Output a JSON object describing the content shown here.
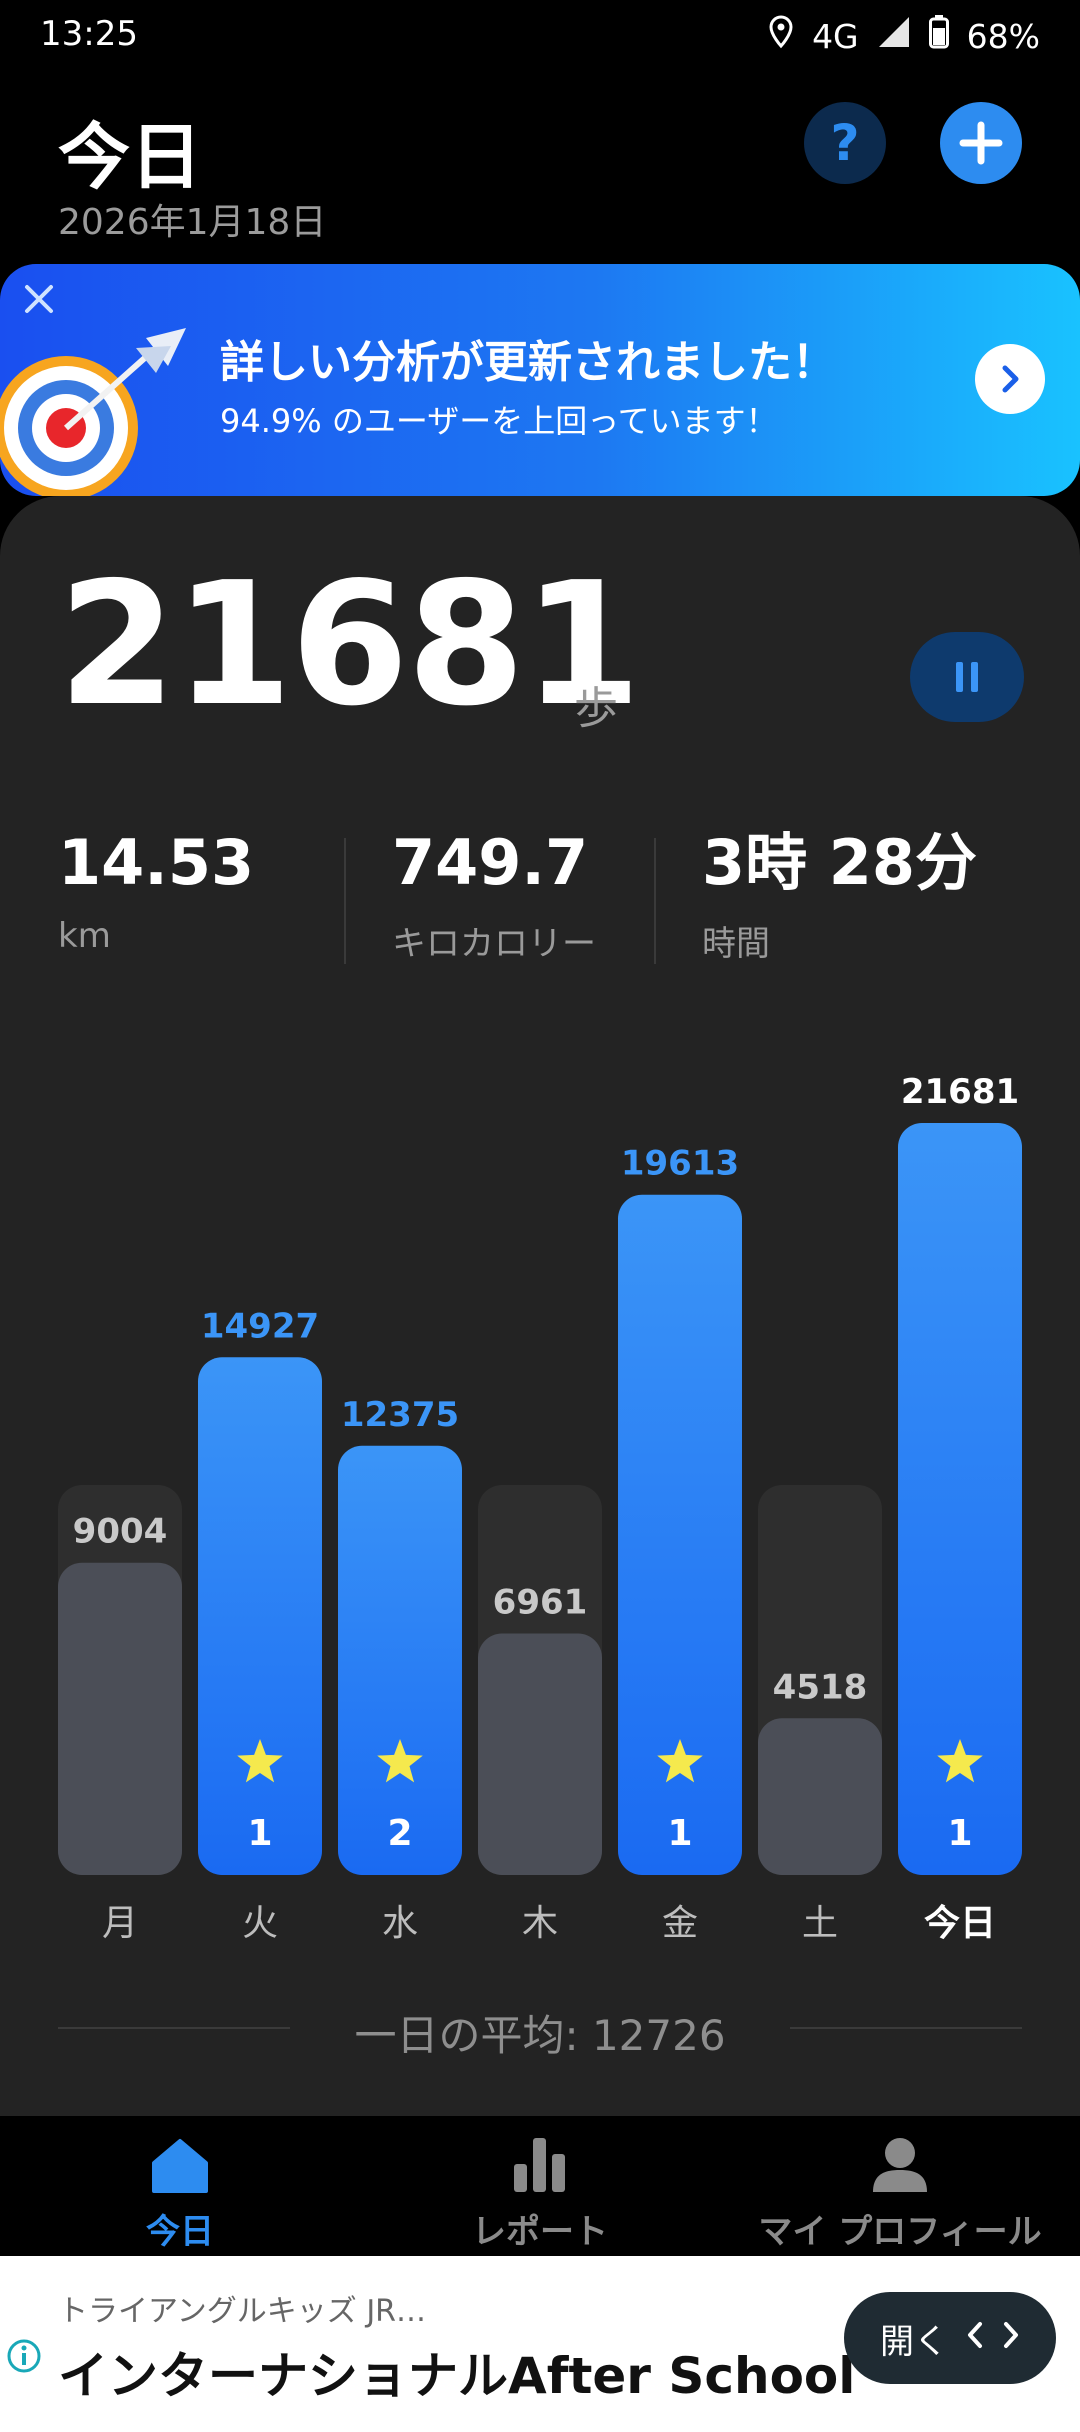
{
  "status_bar": {
    "time": "13:25",
    "network": "4G",
    "battery": "68%",
    "icons": [
      "location-icon",
      "signal-icon",
      "battery-icon"
    ]
  },
  "header": {
    "title": "今日",
    "date": "2026年1月18日",
    "help_icon": "question-icon",
    "add_icon": "plus-icon"
  },
  "banner": {
    "title": "詳しい分析が更新されました！",
    "subtitle": "94.9% のユーザーを上回っています！",
    "close_icon": "close-icon",
    "arrow_icon": "chevron-right-icon"
  },
  "steps": {
    "value": "21681",
    "unit": "歩"
  },
  "stats": [
    {
      "value": "14.53",
      "label": "km"
    },
    {
      "value": "749.7",
      "label": "キロカロリー"
    },
    {
      "value": "3時 28分",
      "label": "時間"
    }
  ],
  "chart_data": {
    "type": "bar",
    "categories": [
      "月",
      "火",
      "水",
      "木",
      "金",
      "土",
      "今日"
    ],
    "values": [
      9004,
      14927,
      12375,
      6961,
      19613,
      4518,
      21681
    ],
    "goal_reached": [
      false,
      true,
      true,
      false,
      true,
      false,
      true
    ],
    "star_counts": [
      null,
      "1",
      "2",
      null,
      "1",
      null,
      "1"
    ],
    "ylim": [
      0,
      21681
    ],
    "colors": {
      "goal_bar": "#2a8af6",
      "regular_bar": "#4b4e57",
      "goal_label": "#3b95f7",
      "regular_label": "#c9c9c9",
      "today_label": "#ffffff",
      "star": "#f5e94d"
    }
  },
  "average": {
    "text": "一日の平均: 12726"
  },
  "nav": {
    "items": [
      {
        "label": "今日",
        "icon": "home-icon",
        "active": true
      },
      {
        "label": "レポート",
        "icon": "bar-chart-icon",
        "active": false
      },
      {
        "label": "マイ プロフィール",
        "icon": "person-icon",
        "active": false
      }
    ],
    "accent": "#2d8cf0"
  },
  "ad": {
    "small": "トライアングルキッズ JR…",
    "title": "インターナショナルAfter School",
    "button": "開く"
  }
}
